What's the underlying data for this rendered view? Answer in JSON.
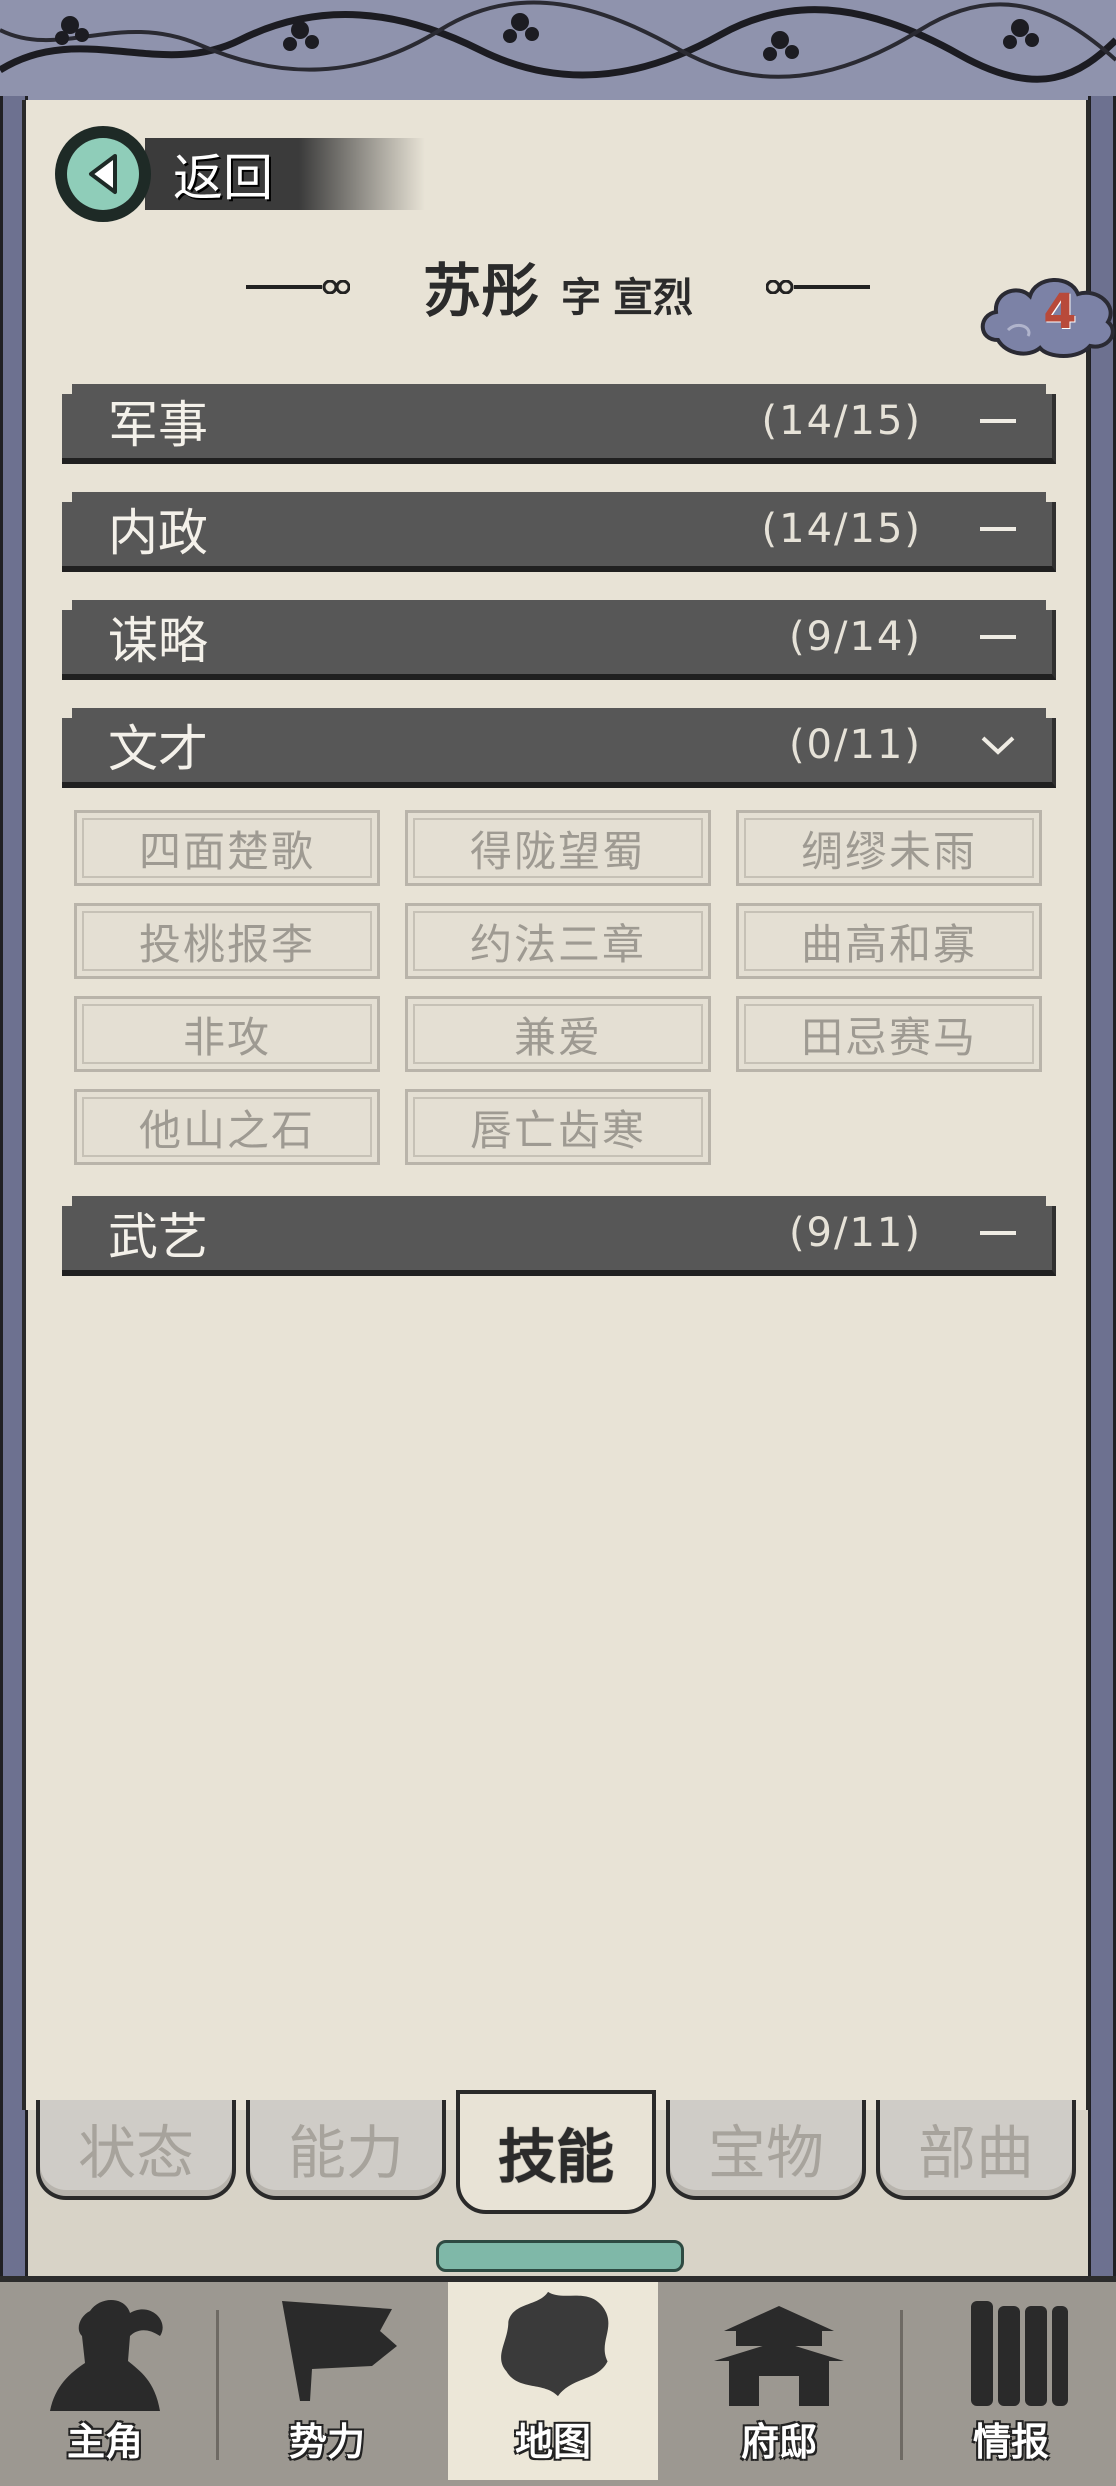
{
  "header": {
    "back_label": "返回",
    "char_name": "苏彤",
    "courtesy_prefix": "字",
    "courtesy_name": "宣烈",
    "badge_count": "4"
  },
  "categories": [
    {
      "label": "军事",
      "count": "(14/15)",
      "state": "collapsed"
    },
    {
      "label": "内政",
      "count": "(14/15)",
      "state": "collapsed"
    },
    {
      "label": "谋略",
      "count": "(9/14)",
      "state": "collapsed"
    },
    {
      "label": "文才",
      "count": "(0/11)",
      "state": "expanded"
    },
    {
      "label": "武艺",
      "count": "(9/11)",
      "state": "collapsed"
    }
  ],
  "skills": [
    "四面楚歌",
    "得陇望蜀",
    "绸缪未雨",
    "投桃报李",
    "约法三章",
    "曲高和寡",
    "非攻",
    "兼爱",
    "田忌赛马",
    "他山之石",
    "唇亡齿寒"
  ],
  "tabs": [
    {
      "label": "状态",
      "active": false
    },
    {
      "label": "能力",
      "active": false
    },
    {
      "label": "技能",
      "active": true
    },
    {
      "label": "宝物",
      "active": false
    },
    {
      "label": "部曲",
      "active": false
    }
  ],
  "nav": [
    {
      "label": "主角",
      "icon": "warrior-icon"
    },
    {
      "label": "势力",
      "icon": "flag-icon"
    },
    {
      "label": "地图",
      "icon": "map-icon",
      "active": true
    },
    {
      "label": "府邸",
      "icon": "mansion-icon"
    },
    {
      "label": "情报",
      "icon": "scroll-icon"
    }
  ],
  "colors": {
    "category_bar": "#575757",
    "parchment": "#e8e3d6",
    "badge_text": "#b84a3a",
    "back_accent": "#8fcdb9"
  }
}
